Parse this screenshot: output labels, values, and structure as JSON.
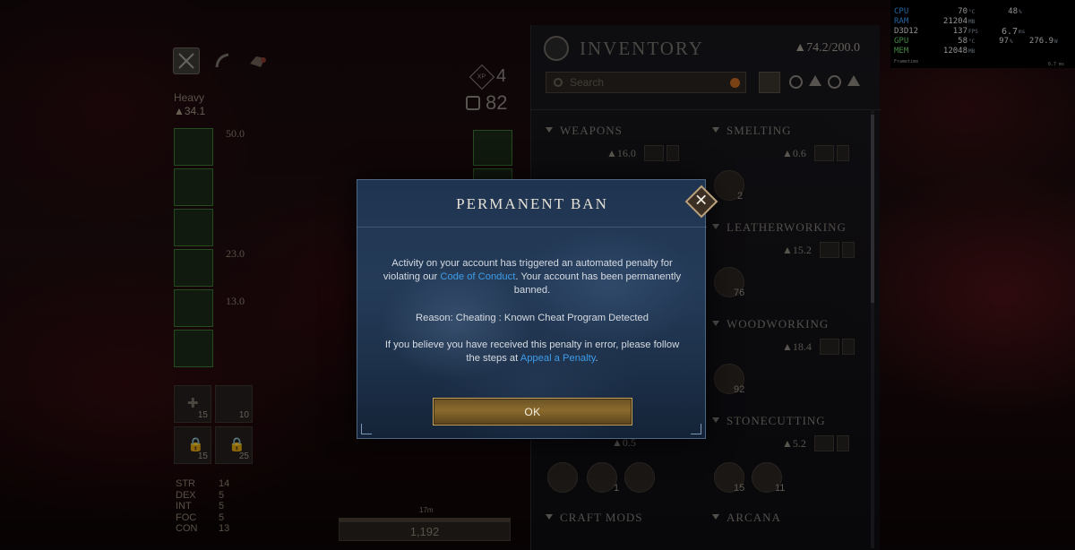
{
  "hud": {
    "rows": [
      {
        "key": "CPU",
        "a": "70",
        "a_unit": "°C",
        "b": "48",
        "b_unit": "%",
        "c": "",
        "c_unit": ""
      },
      {
        "key": "RAM",
        "a": "21204",
        "a_unit": "MB",
        "b": "",
        "b_unit": "",
        "c": "",
        "c_unit": ""
      },
      {
        "key": "D3D12",
        "a": "137",
        "a_unit": "FPS",
        "b": "6.7",
        "b_unit": "ms",
        "c": "",
        "c_unit": ""
      },
      {
        "key": "GPU",
        "a": "58",
        "a_unit": "°C",
        "b": "97",
        "b_unit": "%",
        "c": "276.9",
        "c_unit": "W"
      },
      {
        "key": "MEM",
        "a": "12048",
        "a_unit": "MB",
        "b": "",
        "b_unit": "",
        "c": "",
        "c_unit": ""
      }
    ],
    "frametime_label": "Frametime",
    "frametime_value": "6.7 ms"
  },
  "character": {
    "load_label": "Heavy",
    "load_value": "▲34.1",
    "gear_weights": [
      "50.0",
      "23.0",
      "13.0"
    ],
    "xp_badge": "XP",
    "xp_value": "4",
    "gear_score": "82",
    "consumables": [
      {
        "glyph": "✚",
        "count": "15"
      },
      {
        "glyph": "",
        "count": "10"
      },
      {
        "glyph": "🔒",
        "count": "15"
      },
      {
        "glyph": "🔒",
        "count": "25"
      }
    ],
    "attributes": [
      {
        "k": "STR",
        "v": "14"
      },
      {
        "k": "DEX",
        "v": "5"
      },
      {
        "k": "INT",
        "v": "5"
      },
      {
        "k": "FOC",
        "v": "5"
      },
      {
        "k": "CON",
        "v": "13"
      }
    ],
    "distance_label": "17m",
    "bottom_value": "1,192"
  },
  "inventory": {
    "title": "INVENTORY",
    "weight": "▲74.2/200.0",
    "search_placeholder": "Search",
    "categories": {
      "weapons": {
        "label": "WEAPONS",
        "weight": "▲16.0"
      },
      "smelting": {
        "label": "SMELTING",
        "weight": "▲0.6"
      },
      "leatherworking": {
        "label": "LEATHERWORKING",
        "weight": "▲15.2"
      },
      "woodworking": {
        "label": "WOODWORKING",
        "weight": "▲18.4"
      },
      "stonecutting": {
        "label": "STONECUTTING",
        "weight": "▲5.2"
      },
      "misc_weight": "▲0.5",
      "craft_mods": {
        "label": "CRAFT MODS"
      },
      "arcana": {
        "label": "ARCANA"
      }
    },
    "item_counts": {
      "smelting": "2",
      "leatherworking": "76",
      "woodworking": "92",
      "misc_1": "1",
      "stone_1": "15",
      "stone_2": "11"
    }
  },
  "modal": {
    "title": "PERMANENT BAN",
    "close_glyph": "✕",
    "line1_pre": "Activity on your account has triggered an automated penalty for violating our ",
    "line1_link": "Code of Conduct",
    "line1_post": ". Your account has been permanently banned.",
    "reason": "Reason: Cheating : Known Cheat Program Detected",
    "appeal_pre": "If you believe you have received this penalty in error,  please follow the steps at ",
    "appeal_link": "Appeal a Penalty",
    "appeal_post": ".",
    "ok_label": "OK"
  },
  "colors": {
    "link": "#3f9ce8",
    "ok_border": "#c9a55a",
    "modal_bg": "#243b58",
    "hud_blue": "#3ea2ff",
    "hud_green": "#6ed86e"
  }
}
